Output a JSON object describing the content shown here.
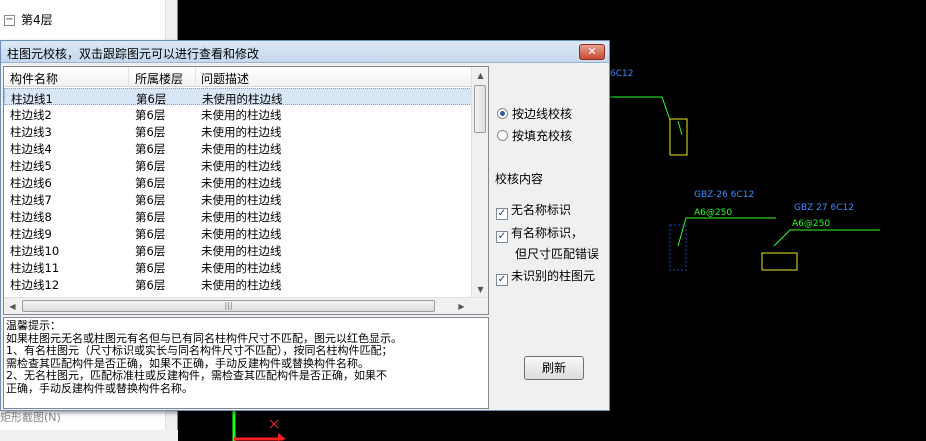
{
  "tree": {
    "rows": [
      {
        "label": "第4层",
        "expander": "−"
      }
    ],
    "bottom_tab": "矩形截图(N)"
  },
  "cad": {
    "labels": [
      {
        "text": "6C12",
        "color": "#3b8cff"
      },
      {
        "text": "GBZ-26 6C12",
        "color": "#3b8cff"
      },
      {
        "text": "A6@250",
        "color": "#2cff2c"
      },
      {
        "text": "GBZ 27 6C12",
        "color": "#3b8cff"
      },
      {
        "text": "A6@250",
        "color": "#2cff2c"
      }
    ],
    "axis_x_color": "#ff2020",
    "axis_y_color": "#20ff20",
    "x_icon": "close-icon"
  },
  "dialog": {
    "title": "柱图元校核，双击跟踪图元可以进行查看和修改",
    "close_glyph": "✕",
    "columns": [
      "构件名称",
      "所属楼层",
      "问题描述"
    ],
    "rows": [
      {
        "name": "柱边线1",
        "floor": "第6层",
        "issue": "未使用的柱边线"
      },
      {
        "name": "柱边线2",
        "floor": "第6层",
        "issue": "未使用的柱边线"
      },
      {
        "name": "柱边线3",
        "floor": "第6层",
        "issue": "未使用的柱边线"
      },
      {
        "name": "柱边线4",
        "floor": "第6层",
        "issue": "未使用的柱边线"
      },
      {
        "name": "柱边线5",
        "floor": "第6层",
        "issue": "未使用的柱边线"
      },
      {
        "name": "柱边线6",
        "floor": "第6层",
        "issue": "未使用的柱边线"
      },
      {
        "name": "柱边线7",
        "floor": "第6层",
        "issue": "未使用的柱边线"
      },
      {
        "name": "柱边线8",
        "floor": "第6层",
        "issue": "未使用的柱边线"
      },
      {
        "name": "柱边线9",
        "floor": "第6层",
        "issue": "未使用的柱边线"
      },
      {
        "name": "柱边线10",
        "floor": "第6层",
        "issue": "未使用的柱边线"
      },
      {
        "name": "柱边线11",
        "floor": "第6层",
        "issue": "未使用的柱边线"
      },
      {
        "name": "柱边线12",
        "floor": "第6层",
        "issue": "未使用的柱边线"
      }
    ],
    "hint_lines": [
      "温馨提示：",
      "如果柱图元无名或柱图元有名但与已有同名柱构件尺寸不匹配，图元以红色显示。",
      "1、有名柱图元（尺寸标识或实长与同名构件尺寸不匹配），按同名柱构件匹配；",
      "需检查其匹配构件是否正确，如果不正确，手动反建构件或替换构件名称。",
      "2、无名柱图元，匹配标准柱或反建构件，需检查其匹配构件是否正确，如果不",
      "正确，手动反建构件或替换构件名称。"
    ],
    "check_modes": [
      {
        "label": "按边线校核",
        "selected": true
      },
      {
        "label": "按填充校核",
        "selected": false
      }
    ],
    "check_content_label": "校核内容",
    "checks": [
      {
        "label": "无名称标识",
        "checked": true
      },
      {
        "label": "有名称标识，",
        "checked": true,
        "sub": "但尺寸匹配错误"
      },
      {
        "label": "未识别的柱图元",
        "checked": true
      }
    ],
    "refresh_label": "刷新",
    "scroll_mid_glyph": "|||"
  }
}
